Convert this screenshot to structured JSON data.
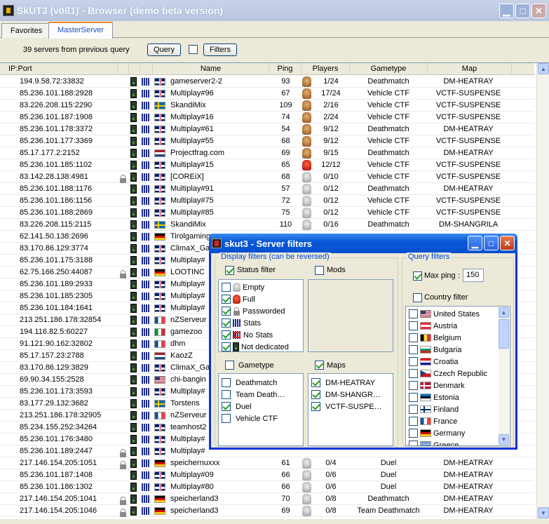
{
  "window": {
    "title": "SkUT3 (v0ß1) - Browser (demo beta version)"
  },
  "tabs": [
    {
      "label": "Favorites"
    },
    {
      "label": "MasterServer"
    }
  ],
  "query": {
    "info": "39 servers from previous query",
    "query_label": "Query",
    "filters_label": "Filters"
  },
  "columns": {
    "ip": "IP:Port",
    "name": "Name",
    "ping": "Ping",
    "players": "Players",
    "gametype": "Gametype",
    "map": "Map"
  },
  "servers": [
    {
      "ip": "194.9.58.72:33832",
      "lock": false,
      "flag": "uk",
      "name": "gameserver2-2",
      "ping": "93",
      "face": "tan",
      "players": "1/24",
      "gametype": "Deathmatch",
      "map": "DM-HEATRAY"
    },
    {
      "ip": "85.236.101.188:2928",
      "lock": false,
      "flag": "uk",
      "name": "Multiplay#96",
      "ping": "67",
      "face": "tan",
      "players": "17/24",
      "gametype": "Vehicle CTF",
      "map": "VCTF-SUSPENSE"
    },
    {
      "ip": "83.226.208.115:2290",
      "lock": false,
      "flag": "se",
      "name": "SkandiMix",
      "ping": "109",
      "face": "tan",
      "players": "2/16",
      "gametype": "Vehicle CTF",
      "map": "VCTF-SUSPENSE"
    },
    {
      "ip": "85.236.101.187:1908",
      "lock": false,
      "flag": "uk",
      "name": "Multiplay#16",
      "ping": "74",
      "face": "tan",
      "players": "2/24",
      "gametype": "Vehicle CTF",
      "map": "VCTF-SUSPENSE"
    },
    {
      "ip": "85.236.101.178:3372",
      "lock": false,
      "flag": "uk",
      "name": "Multiplay#61",
      "ping": "54",
      "face": "tan",
      "players": "9/12",
      "gametype": "Deathmatch",
      "map": "DM-HEATRAY"
    },
    {
      "ip": "85.236.101.177:3369",
      "lock": false,
      "flag": "uk",
      "name": "Multiplay#55",
      "ping": "68",
      "face": "tan",
      "players": "9/12",
      "gametype": "Vehicle CTF",
      "map": "VCTF-SUSPENSE"
    },
    {
      "ip": "85.17.177.2:2152",
      "lock": false,
      "flag": "nl",
      "name": "Projectfrag.com",
      "ping": "69",
      "face": "tan",
      "players": "9/15",
      "gametype": "Deathmatch",
      "map": "DM-HEATRAY"
    },
    {
      "ip": "85.236.101.185:1102",
      "lock": false,
      "flag": "uk",
      "name": "Multiplay#15",
      "ping": "65",
      "face": "red",
      "players": "12/12",
      "gametype": "Vehicle CTF",
      "map": "VCTF-SUSPENSE"
    },
    {
      "ip": "83.142.28.138:4981",
      "lock": true,
      "flag": "uk",
      "name": "[COREiX]",
      "ping": "68",
      "face": "gray",
      "players": "0/10",
      "gametype": "Vehicle CTF",
      "map": "VCTF-SUSPENSE"
    },
    {
      "ip": "85.236.101.188:1176",
      "lock": false,
      "flag": "uk",
      "name": "Multiplay#91",
      "ping": "57",
      "face": "gray",
      "players": "0/12",
      "gametype": "Deathmatch",
      "map": "DM-HEATRAY"
    },
    {
      "ip": "85.236.101.186:1156",
      "lock": false,
      "flag": "uk",
      "name": "Multiplay#75",
      "ping": "72",
      "face": "gray",
      "players": "0/12",
      "gametype": "Vehicle CTF",
      "map": "VCTF-SUSPENSE"
    },
    {
      "ip": "85.236.101.188:2869",
      "lock": false,
      "flag": "uk",
      "name": "Multiplay#85",
      "ping": "75",
      "face": "gray",
      "players": "0/12",
      "gametype": "Vehicle CTF",
      "map": "VCTF-SUSPENSE"
    },
    {
      "ip": "83.226.208.115:2115",
      "lock": false,
      "flag": "se",
      "name": "SkandiMix",
      "ping": "110",
      "face": "gray",
      "players": "0/16",
      "gametype": "Deathmatch",
      "map": "DM-SHANGRILA"
    },
    {
      "ip": "62.141.50.138:2696",
      "lock": false,
      "flag": "de",
      "name": "Tirolgaming",
      "ping": "",
      "face": "",
      "players": "",
      "gametype": "",
      "map": ""
    },
    {
      "ip": "83.170.86.129:3774",
      "lock": false,
      "flag": "uk",
      "name": "ClimaX_Ga",
      "ping": "",
      "face": "",
      "players": "",
      "gametype": "",
      "map": ""
    },
    {
      "ip": "85.236.101.175:3188",
      "lock": false,
      "flag": "uk",
      "name": "Multiplay#",
      "ping": "",
      "face": "",
      "players": "",
      "gametype": "",
      "map": ""
    },
    {
      "ip": "62.75.166.250:44087",
      "lock": true,
      "flag": "de",
      "name": "LOOTINC",
      "ping": "",
      "face": "",
      "players": "",
      "gametype": "",
      "map": ""
    },
    {
      "ip": "85.236.101.189:2933",
      "lock": false,
      "flag": "uk",
      "name": "Multiplay#",
      "ping": "",
      "face": "",
      "players": "",
      "gametype": "",
      "map": ""
    },
    {
      "ip": "85.236.101.185:2305",
      "lock": false,
      "flag": "uk",
      "name": "Multiplay#",
      "ping": "",
      "face": "",
      "players": "",
      "gametype": "",
      "map": ""
    },
    {
      "ip": "85.236.101.184:1641",
      "lock": false,
      "flag": "uk",
      "name": "Multiplay#",
      "ping": "",
      "face": "",
      "players": "",
      "gametype": "",
      "map": ""
    },
    {
      "ip": "213.251.186.178:32854",
      "lock": false,
      "flag": "fr",
      "name": "nZServeur",
      "ping": "",
      "face": "",
      "players": "",
      "gametype": "",
      "map": ""
    },
    {
      "ip": "194.116.82.5:60227",
      "lock": false,
      "flag": "it",
      "name": "gamezoo",
      "ping": "",
      "face": "",
      "players": "",
      "gametype": "",
      "map": ""
    },
    {
      "ip": "91.121.90.162:32802",
      "lock": false,
      "flag": "fr",
      "name": "dhm",
      "ping": "",
      "face": "",
      "players": "",
      "gametype": "",
      "map": ""
    },
    {
      "ip": "85.17.157.23:2788",
      "lock": false,
      "flag": "nl",
      "name": "KaozZ",
      "ping": "",
      "face": "",
      "players": "",
      "gametype": "",
      "map": ""
    },
    {
      "ip": "83.170.86.129:3829",
      "lock": false,
      "flag": "uk",
      "name": "ClimaX_Ga",
      "ping": "",
      "face": "",
      "players": "",
      "gametype": "",
      "map": ""
    },
    {
      "ip": "69.90.34.155:2528",
      "lock": false,
      "flag": "us",
      "name": "chi-bangin",
      "ping": "",
      "face": "",
      "players": "",
      "gametype": "",
      "map": ""
    },
    {
      "ip": "85.236.101.173:3593",
      "lock": false,
      "flag": "uk",
      "name": "Multiplay#",
      "ping": "",
      "face": "",
      "players": "",
      "gametype": "",
      "map": ""
    },
    {
      "ip": "83.177.29.132:3682",
      "lock": false,
      "flag": "se",
      "name": "Torstens",
      "ping": "",
      "face": "",
      "players": "",
      "gametype": "",
      "map": ""
    },
    {
      "ip": "213.251.186.178:32905",
      "lock": false,
      "flag": "fr",
      "name": "nZServeur",
      "ping": "",
      "face": "",
      "players": "",
      "gametype": "",
      "map": ""
    },
    {
      "ip": "85.234.155.252:34264",
      "lock": false,
      "flag": "uk",
      "name": "teamhost2",
      "ping": "",
      "face": "",
      "players": "",
      "gametype": "",
      "map": ""
    },
    {
      "ip": "85.236.101.176:3480",
      "lock": false,
      "flag": "uk",
      "name": "Multiplay#",
      "ping": "",
      "face": "",
      "players": "",
      "gametype": "",
      "map": ""
    },
    {
      "ip": "85.236.101.189:2447",
      "lock": true,
      "flag": "uk",
      "name": "Multiplay#",
      "ping": "",
      "face": "",
      "players": "",
      "gametype": "",
      "map": ""
    },
    {
      "ip": "217.146.154.205:1051",
      "lock": true,
      "flag": "de",
      "name": "speichernuxxx",
      "ping": "61",
      "face": "gray",
      "players": "0/4",
      "gametype": "Duel",
      "map": "DM-HEATRAY"
    },
    {
      "ip": "85.236.101.187:1408",
      "lock": false,
      "flag": "uk",
      "name": "Multiplay#09",
      "ping": "66",
      "face": "gray",
      "players": "0/6",
      "gametype": "Duel",
      "map": "DM-HEATRAY"
    },
    {
      "ip": "85.236.101.186:1302",
      "lock": false,
      "flag": "uk",
      "name": "Multiplay#80",
      "ping": "66",
      "face": "gray",
      "players": "0/6",
      "gametype": "Duel",
      "map": "DM-HEATRAY"
    },
    {
      "ip": "217.146.154.205:1041",
      "lock": true,
      "flag": "de",
      "name": "speicherland3",
      "ping": "70",
      "face": "gray",
      "players": "0/8",
      "gametype": "Deathmatch",
      "map": "DM-HEATRAY"
    },
    {
      "ip": "217.146.154.205:1046",
      "lock": true,
      "flag": "de",
      "name": "speicherland3",
      "ping": "69",
      "face": "gray",
      "players": "0/8",
      "gametype": "Team Deathmatch",
      "map": "DM-HEATRAY"
    }
  ],
  "dialog": {
    "title": "skut3 - Server filters",
    "display_legend": "Display filters (can be reversed)",
    "query_legend": "Query filters",
    "status_filter": {
      "label": "Status filter",
      "checked": true
    },
    "mods": {
      "label": "Mods",
      "checked": false
    },
    "status_items": [
      {
        "label": "Empty",
        "checked": false,
        "icon": "gray-face-icon"
      },
      {
        "label": "Full",
        "checked": true,
        "icon": "red-face-icon"
      },
      {
        "label": "Passworded",
        "checked": true,
        "icon": "lock-icon"
      },
      {
        "label": "Stats",
        "checked": true,
        "icon": "stats-icon"
      },
      {
        "label": "No Stats",
        "checked": true,
        "icon": "no-stats-icon"
      },
      {
        "label": "Not dedicated",
        "checked": true,
        "icon": "server-icon"
      }
    ],
    "gametype": {
      "label": "Gametype",
      "checked": false
    },
    "gametype_items": [
      {
        "label": "Deathmatch",
        "checked": false
      },
      {
        "label": "Team Death…",
        "checked": false
      },
      {
        "label": "Duel",
        "checked": true
      },
      {
        "label": "Vehicle CTF",
        "checked": false
      }
    ],
    "maps": {
      "label": "Maps",
      "checked": true
    },
    "map_items": [
      {
        "label": "DM-HEATRAY",
        "checked": true
      },
      {
        "label": "DM-SHANGR…",
        "checked": true
      },
      {
        "label": "VCTF-SUSPE…",
        "checked": true
      }
    ],
    "max_ping": {
      "label": "Max ping :",
      "checked": true,
      "value": "150"
    },
    "country_filter": {
      "label": "Country filter",
      "checked": false
    },
    "countries": [
      {
        "label": "United States",
        "flag": "us"
      },
      {
        "label": "Austria",
        "flag": "at"
      },
      {
        "label": "Belgium",
        "flag": "be"
      },
      {
        "label": "Bulgaria",
        "flag": "bg"
      },
      {
        "label": "Croatia",
        "flag": "hr"
      },
      {
        "label": "Czech Republic",
        "flag": "cz"
      },
      {
        "label": "Denmark",
        "flag": "dk"
      },
      {
        "label": "Estonia",
        "flag": "ee"
      },
      {
        "label": "Finland",
        "flag": "fi"
      },
      {
        "label": "France",
        "flag": "fr"
      },
      {
        "label": "Germany",
        "flag": "de"
      },
      {
        "label": "Greece",
        "flag": "gr"
      }
    ]
  }
}
